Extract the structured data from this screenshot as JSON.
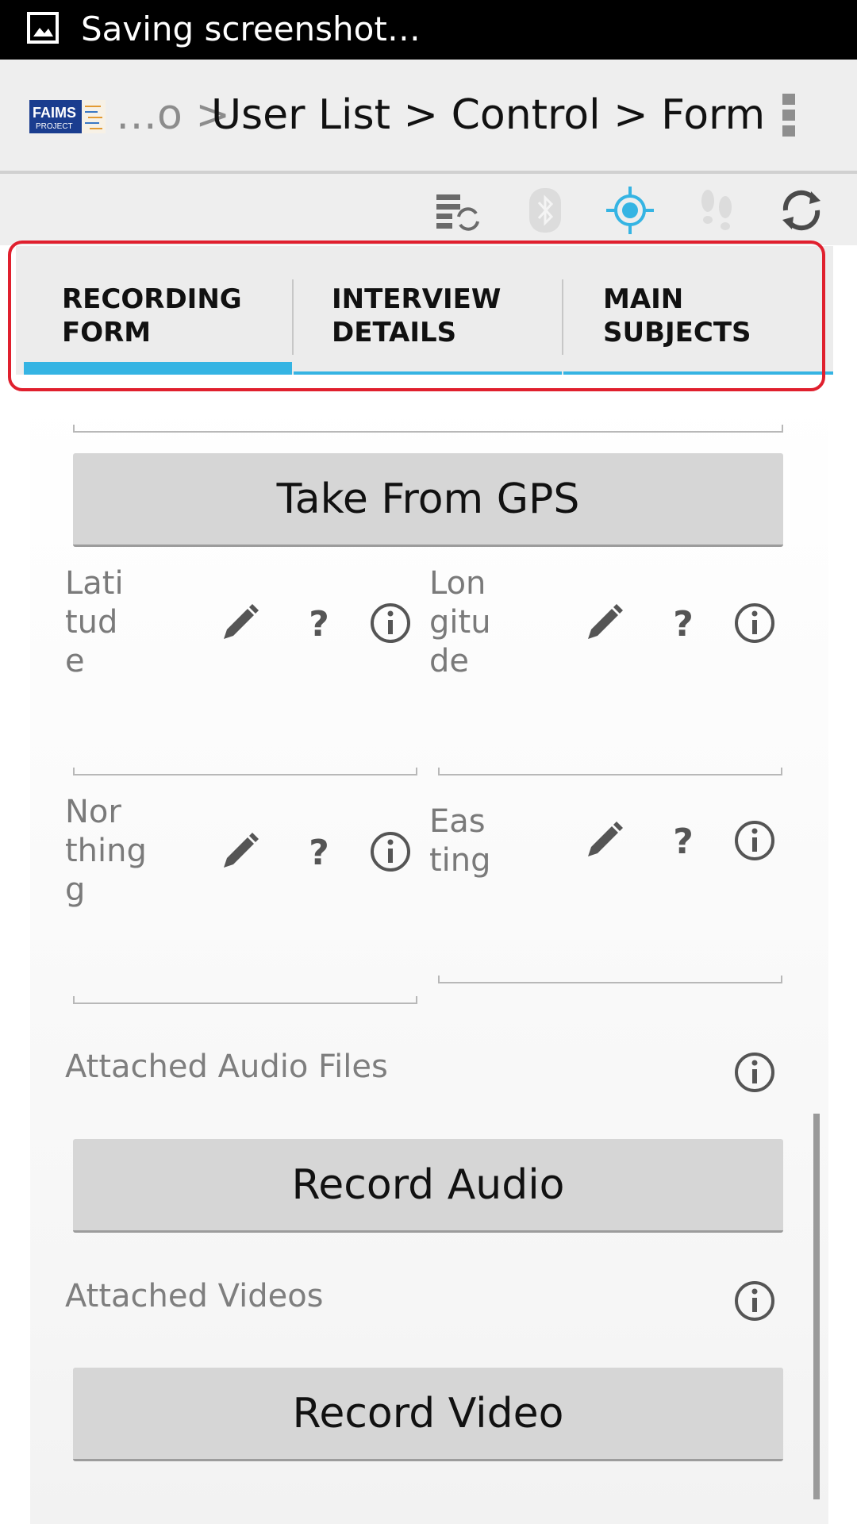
{
  "status_bar": {
    "text": "Saving screenshot…"
  },
  "action_bar": {
    "logo_text": "FAIMS",
    "logo_subtext": "PROJECT",
    "breadcrumb_prefix": "…o >",
    "breadcrumb_main": "User List > Control > Form"
  },
  "tabs": [
    {
      "label": "RECORDING\nFORM"
    },
    {
      "label": "INTERVIEW\nDETAILS"
    },
    {
      "label": "MAIN\nSUBJECTS"
    }
  ],
  "buttons": {
    "gps": "Take From GPS",
    "audio": "Record Audio",
    "video": "Record Video"
  },
  "fields": {
    "latitude": "Lati\ntud\ne",
    "longitude": "Lon\ngitu\nde",
    "northing": "Nor\nthing\ng",
    "easting": "Eas\nting"
  },
  "sections": {
    "audio_files": "Attached Audio Files",
    "videos": "Attached Videos"
  },
  "colors": {
    "accent": "#35b4e3",
    "highlight": "#e0202e"
  }
}
